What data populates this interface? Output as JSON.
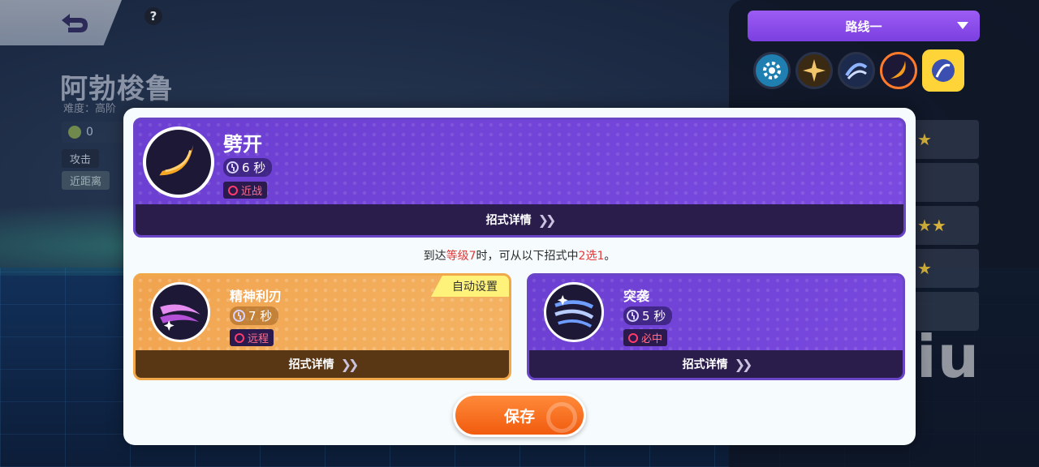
{
  "background": {
    "hero_name": "阿勃梭鲁",
    "difficulty": "难度：高阶",
    "stat_value": "0",
    "tag_attack": "攻击",
    "tag_range": "近距离"
  },
  "route_selector": {
    "label": "路线一"
  },
  "skill_bar": [
    "gear-skill-icon",
    "burst-skill-icon",
    "swirl-skill-icon",
    "crescent-skill-icon",
    "unite-skill-icon"
  ],
  "watermark": "biubiu",
  "modal": {
    "main_skill": {
      "name": "劈开",
      "cooldown": "6 秒",
      "type": "近战",
      "details_label": "招式详情"
    },
    "prompt": {
      "prefix": "到达",
      "highlight_level": "等级7",
      "middle": "时，可从以下招式中",
      "highlight_choice": "2选1",
      "suffix": "。"
    },
    "options": [
      {
        "name": "精神利刃",
        "cooldown": "7 秒",
        "type": "远程",
        "tag": "自动设置",
        "details_label": "招式详情"
      },
      {
        "name": "突袭",
        "cooldown": "5 秒",
        "type": "必中",
        "details_label": "招式详情"
      }
    ],
    "save_label": "保存"
  },
  "colors": {
    "accent_purple": "#7b4ae0",
    "accent_orange": "#f15b0e",
    "highlight_red": "#e23a3a",
    "option_orange": "#f1a34e"
  }
}
